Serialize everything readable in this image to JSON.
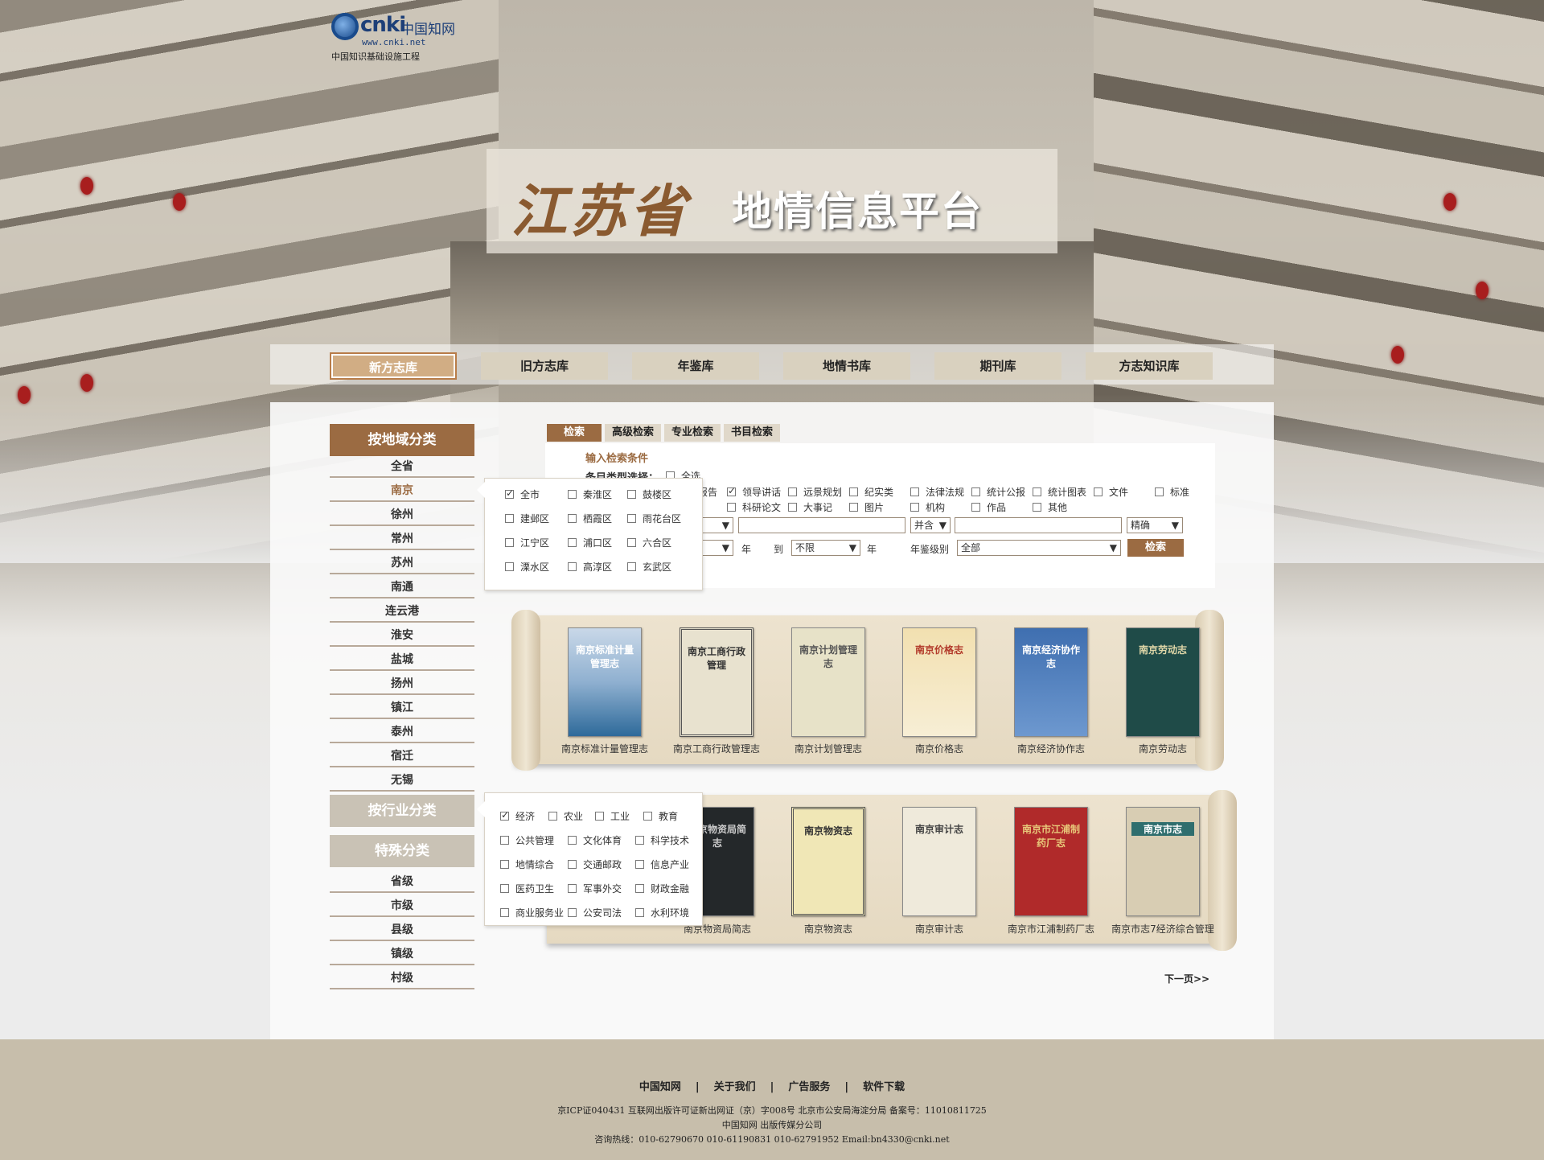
{
  "logo": {
    "brand": "cnki",
    "cn": "中国知网",
    "url": "www.cnki.net",
    "sub": "中国知识基础设施工程"
  },
  "banner": {
    "title_art": "江苏省",
    "title_main": "地情信息平台"
  },
  "tabs": [
    "新方志库",
    "旧方志库",
    "年鉴库",
    "地情书库",
    "期刊库",
    "方志知识库"
  ],
  "sidebar": {
    "region_header": "按地域分类",
    "regions": [
      "全省",
      "南京",
      "徐州",
      "常州",
      "苏州",
      "南通",
      "连云港",
      "淮安",
      "盐城",
      "扬州",
      "镇江",
      "泰州",
      "宿迁",
      "无锡"
    ],
    "industry_header": "按行业分类",
    "special_header": "特殊分类",
    "levels": [
      "省级",
      "市级",
      "县级",
      "镇级",
      "村级"
    ]
  },
  "region_popup": [
    [
      "全市",
      "秦淮区",
      "鼓楼区"
    ],
    [
      "建邺区",
      "栖霞区",
      "雨花台区"
    ],
    [
      "江宁区",
      "浦口区",
      "六合区"
    ],
    [
      "溧水区",
      "高淳区",
      "玄武区"
    ]
  ],
  "industry_popup": [
    [
      "经济",
      "农业",
      "工业",
      "教育"
    ],
    [
      "公共管理",
      "文化体育",
      "科学技术"
    ],
    [
      "地情综合",
      "交通邮政",
      "信息产业"
    ],
    [
      "医药卫生",
      "军事外交",
      "财政金融"
    ],
    [
      "商业服务业",
      "公安司法",
      "水利环境"
    ]
  ],
  "search": {
    "tabs": [
      "检索",
      "高级检索",
      "专业检索",
      "书目检索"
    ],
    "title": "输入检索条件",
    "type_label": "条目类型选择：",
    "select_all": "全选",
    "types_row1": [
      "报告",
      "领导讲话",
      "远景规划",
      "纪实类",
      "法律法规",
      "统计公报",
      "统计图表",
      "文件",
      "标准"
    ],
    "types_row2": [
      "科研论文",
      "大事记",
      "图片",
      "机构",
      "作品",
      "其他"
    ],
    "logic": "并含",
    "match": "精确",
    "year_from_suffix": "年",
    "to": "到",
    "year_to": "不限",
    "year_to_suffix": "年",
    "level_label": "年鉴级别",
    "level_value": "全部",
    "button": "检索"
  },
  "books_row1": [
    "南京标准计量管理志",
    "南京工商行政管理志",
    "南京计划管理志",
    "南京价格志",
    "南京经济协作志",
    "南京劳动志"
  ],
  "books_row2": [
    "南京物资局简志",
    "南京物资志",
    "南京审计志",
    "南京市江浦制药厂志",
    "南京市志7经济综合管理"
  ],
  "next_page": "下一页>>",
  "footer": {
    "links": [
      "中国知网",
      "关于我们",
      "广告服务",
      "软件下载"
    ],
    "line1": "京ICP证040431  互联网出版许可证新出网证（京）字008号  北京市公安局海淀分局  备案号：11010811725",
    "line2": "中国知网  出版传媒分公司",
    "line3": "咨询热线：010-62790670   010-61190831   010-62791952   Email:bn4330@cnki.net"
  }
}
